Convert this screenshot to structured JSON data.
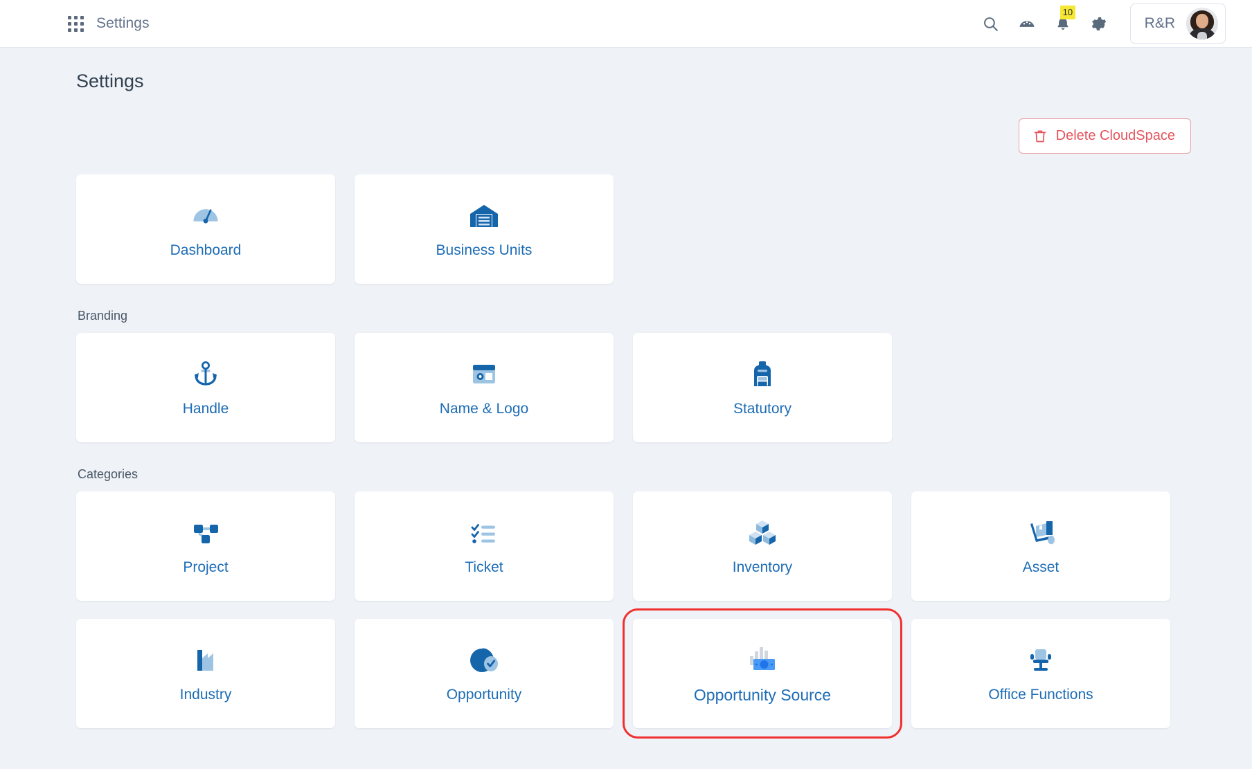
{
  "topbar": {
    "apps_icon": "grid-apps-icon",
    "app_title": "Settings",
    "icons": [
      {
        "name": "search-icon",
        "label": "Search"
      },
      {
        "name": "gauge-icon",
        "label": "Dashboard"
      },
      {
        "name": "bell-icon",
        "label": "Notifications",
        "badge": "10"
      },
      {
        "name": "gear-icon",
        "label": "Settings"
      }
    ],
    "notification_count": "10",
    "user_label": "R&R",
    "avatar_name": "user-avatar"
  },
  "page": {
    "title": "Settings"
  },
  "actions": {
    "delete_label": "Delete CloudSpace",
    "delete_icon": "trash-icon",
    "delete_color": "#e4545c"
  },
  "sections": [
    {
      "label": "",
      "cards": [
        {
          "label": "Dashboard",
          "icon": "gauge-icon"
        },
        {
          "label": "Business Units",
          "icon": "warehouse-icon"
        }
      ]
    },
    {
      "label": "Branding",
      "cards": [
        {
          "label": "Handle",
          "icon": "anchor-icon"
        },
        {
          "label": "Name & Logo",
          "icon": "id-card-icon"
        },
        {
          "label": "Statutory",
          "icon": "backpack-icon"
        }
      ]
    },
    {
      "label": "Categories",
      "cards": [
        {
          "label": "Project",
          "icon": "sitemap-icon"
        },
        {
          "label": "Ticket",
          "icon": "checklist-icon"
        },
        {
          "label": "Inventory",
          "icon": "boxes-icon"
        },
        {
          "label": "Asset",
          "icon": "dolly-icon"
        },
        {
          "label": "Industry",
          "icon": "factory-icon"
        },
        {
          "label": "Opportunity",
          "icon": "pie-check-icon"
        },
        {
          "label": "Opportunity Source",
          "icon": "money-chart-icon",
          "highlighted": true
        },
        {
          "label": "Office Functions",
          "icon": "office-chair-icon"
        }
      ]
    }
  ],
  "colors": {
    "page_bg": "#eff2f7",
    "card_bg": "#ffffff",
    "link_blue": "#1d6cb5",
    "icon_dark_blue": "#1565ab",
    "icon_light_blue": "#9ec4e4",
    "highlight_red": "#f0302f",
    "badge_yellow": "#f5e733"
  }
}
